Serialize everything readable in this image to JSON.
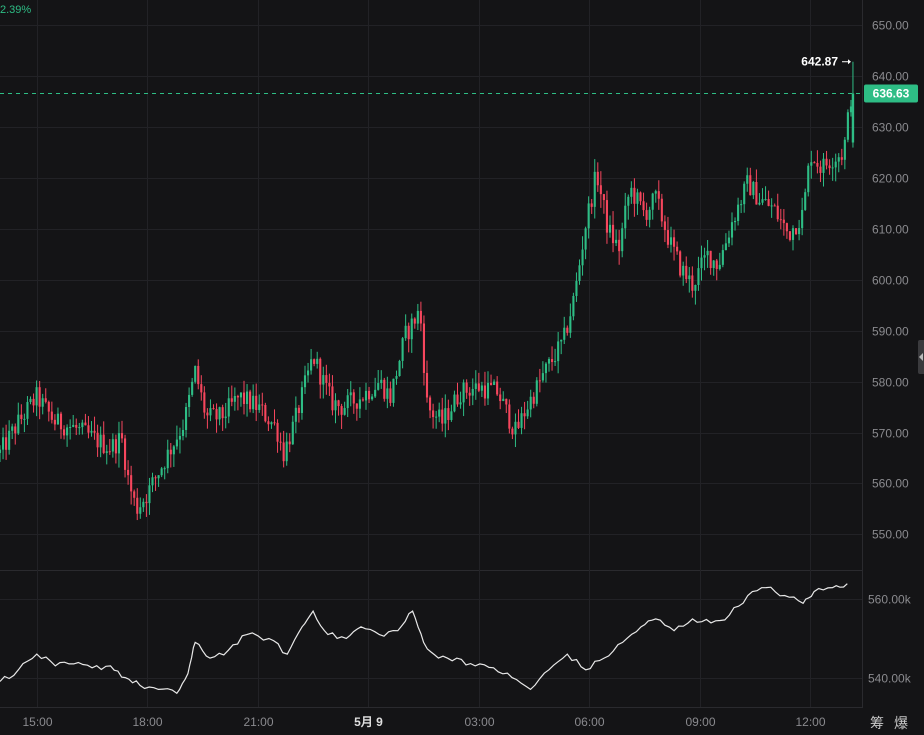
{
  "chart_data": [
    {
      "type": "candlestick",
      "title": "",
      "change_label": "2.39%",
      "y_ticks": [
        550,
        560,
        570,
        580,
        590,
        600,
        610,
        620,
        630,
        640,
        650
      ],
      "y_tick_labels": [
        "550.00",
        "560.00",
        "570.00",
        "580.00",
        "590.00",
        "600.00",
        "610.00",
        "620.00",
        "630.00",
        "640.00",
        "650.00"
      ],
      "ylim": [
        543,
        655
      ],
      "x_tick_labels": [
        "15:00",
        "18:00",
        "21:00",
        "5月 9",
        "03:00",
        "06:00",
        "09:00",
        "12:00"
      ],
      "x_tick_hours": [
        1,
        4,
        7,
        10,
        13,
        16,
        19,
        22
      ],
      "x_range_hours": [
        0,
        23.4
      ],
      "current_price": 636.63,
      "current_price_label": "636.63",
      "high_marker": 642.87,
      "high_marker_label": "642.87",
      "grid": true,
      "colors": {
        "up": "#2ebd85",
        "down": "#f6465d",
        "price_tag": "#2ebd85"
      },
      "close_path": [
        [
          0,
          566
        ],
        [
          0.5,
          572
        ],
        [
          1,
          577
        ],
        [
          1.5,
          572
        ],
        [
          2,
          571
        ],
        [
          2.5,
          569
        ],
        [
          3,
          567
        ],
        [
          3.3,
          569
        ],
        [
          3.5,
          560
        ],
        [
          3.7,
          555
        ],
        [
          4,
          558
        ],
        [
          4.5,
          565
        ],
        [
          5,
          572
        ],
        [
          5.3,
          582
        ],
        [
          5.6,
          573
        ],
        [
          6,
          573
        ],
        [
          6.5,
          577
        ],
        [
          7,
          575
        ],
        [
          7.5,
          571
        ],
        [
          7.7,
          566
        ],
        [
          8,
          572
        ],
        [
          8.5,
          585
        ],
        [
          9,
          576
        ],
        [
          9.3,
          575
        ],
        [
          9.8,
          577
        ],
        [
          10.3,
          580
        ],
        [
          10.6,
          577
        ],
        [
          11,
          589
        ],
        [
          11.4,
          594
        ],
        [
          11.6,
          575
        ],
        [
          12,
          572
        ],
        [
          12.5,
          578
        ],
        [
          13,
          579
        ],
        [
          13.5,
          578
        ],
        [
          14,
          570
        ],
        [
          14.3,
          575
        ],
        [
          14.8,
          582
        ],
        [
          15.3,
          588
        ],
        [
          15.6,
          597
        ],
        [
          15.9,
          611
        ],
        [
          16.2,
          621
        ],
        [
          16.5,
          610
        ],
        [
          16.8,
          606
        ],
        [
          17.1,
          618
        ],
        [
          17.5,
          613
        ],
        [
          17.8,
          616
        ],
        [
          18.2,
          607
        ],
        [
          18.5,
          602
        ],
        [
          18.8,
          599
        ],
        [
          19.2,
          605
        ],
        [
          19.5,
          603
        ],
        [
          19.9,
          612
        ],
        [
          20.3,
          619
        ],
        [
          20.6,
          616
        ],
        [
          21,
          614
        ],
        [
          21.4,
          609
        ],
        [
          21.8,
          613
        ],
        [
          22,
          625
        ],
        [
          22.3,
          622
        ],
        [
          22.6,
          624
        ],
        [
          22.9,
          625
        ],
        [
          23.1,
          636
        ]
      ]
    },
    {
      "type": "line",
      "title": "",
      "y_ticks": [
        540000,
        560000
      ],
      "y_tick_labels": [
        "540.00k",
        "560.00k"
      ],
      "ylim": [
        533000,
        567000
      ],
      "x_range_hours": [
        0,
        23.4
      ],
      "line_color": "#e8e8e8",
      "points": [
        [
          0,
          539000
        ],
        [
          0.5,
          542000
        ],
        [
          1,
          546000
        ],
        [
          1.5,
          543000
        ],
        [
          2,
          543500
        ],
        [
          2.5,
          542500
        ],
        [
          3,
          543000
        ],
        [
          3.4,
          540000
        ],
        [
          3.8,
          538000
        ],
        [
          4.3,
          537000
        ],
        [
          4.8,
          536000
        ],
        [
          5.1,
          541000
        ],
        [
          5.3,
          549000
        ],
        [
          5.7,
          545000
        ],
        [
          6.2,
          547000
        ],
        [
          6.7,
          551000
        ],
        [
          7.3,
          550000
        ],
        [
          7.8,
          546000
        ],
        [
          8.2,
          553000
        ],
        [
          8.5,
          557000
        ],
        [
          8.9,
          551000
        ],
        [
          9.4,
          550000
        ],
        [
          9.8,
          553000
        ],
        [
          10.3,
          551000
        ],
        [
          10.8,
          552000
        ],
        [
          11.2,
          557000
        ],
        [
          11.5,
          549000
        ],
        [
          11.9,
          545000
        ],
        [
          12.4,
          545000
        ],
        [
          12.9,
          543000
        ],
        [
          13.4,
          542500
        ],
        [
          13.9,
          540000
        ],
        [
          14.4,
          537000
        ],
        [
          14.9,
          542000
        ],
        [
          15.4,
          546000
        ],
        [
          15.9,
          542000
        ],
        [
          16.4,
          545000
        ],
        [
          16.9,
          549000
        ],
        [
          17.4,
          553000
        ],
        [
          17.8,
          555000
        ],
        [
          18.3,
          552000
        ],
        [
          18.8,
          555000
        ],
        [
          19.3,
          554000
        ],
        [
          19.8,
          556000
        ],
        [
          20.3,
          561000
        ],
        [
          20.8,
          563000
        ],
        [
          21.3,
          561000
        ],
        [
          21.8,
          559000
        ],
        [
          22.1,
          562000
        ],
        [
          22.6,
          563000
        ],
        [
          23.0,
          564000
        ]
      ]
    }
  ]
}
